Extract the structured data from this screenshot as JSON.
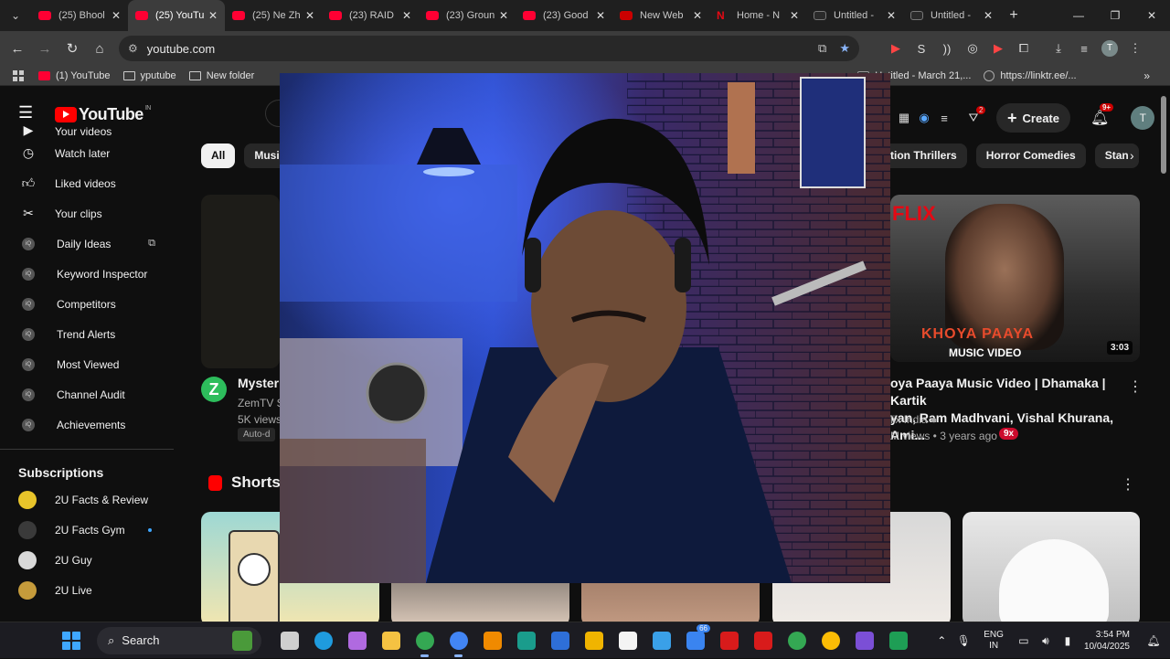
{
  "browser": {
    "tabs": [
      {
        "title": "(25) Bhool",
        "icon": "youtube-icon",
        "active": false
      },
      {
        "title": "(25) YouTu",
        "icon": "youtube-icon",
        "active": true
      },
      {
        "title": "(25) Ne Zh",
        "icon": "youtube-icon",
        "active": false
      },
      {
        "title": "(23) RAID",
        "icon": "youtube-icon",
        "active": false
      },
      {
        "title": "(23) Groun",
        "icon": "youtube-icon",
        "active": false
      },
      {
        "title": "(23) Good",
        "icon": "youtube-icon",
        "active": false
      },
      {
        "title": "New Web",
        "icon": "360-icon",
        "active": false
      },
      {
        "title": "Home - N",
        "icon": "netflix-icon",
        "active": false
      },
      {
        "title": "Untitled -",
        "icon": "app-icon",
        "active": false
      },
      {
        "title": "Untitled -",
        "icon": "app-icon",
        "active": false
      }
    ],
    "url": "youtube.com",
    "bookmarks": [
      {
        "label": "(1) YouTube",
        "icon": "youtube-icon"
      },
      {
        "label": "yputube",
        "icon": "folder-icon"
      },
      {
        "label": "New folder",
        "icon": "folder-icon"
      },
      {
        "label": "Untitled - March 21,...",
        "icon": "app-icon"
      },
      {
        "label": "https://linktr.ee/...",
        "icon": "link-icon"
      }
    ],
    "profile_initial": "T"
  },
  "youtube": {
    "logo_text": "YouTube",
    "logo_region": "IN",
    "create_label": "Create",
    "notifications": "9+",
    "filter_badge": "2",
    "avatar_initial": "T",
    "sidebar": {
      "items": [
        {
          "label": "Your videos",
          "icon": "video-icon"
        },
        {
          "label": "Watch later",
          "icon": "clock-icon"
        },
        {
          "label": "Liked videos",
          "icon": "thumbs-up-icon"
        },
        {
          "label": "Your clips",
          "icon": "scissors-icon"
        },
        {
          "label": "Daily Ideas",
          "icon": "vidiq-icon"
        },
        {
          "label": "Keyword Inspector",
          "icon": "vidiq-icon"
        },
        {
          "label": "Competitors",
          "icon": "vidiq-icon"
        },
        {
          "label": "Trend Alerts",
          "icon": "vidiq-icon"
        },
        {
          "label": "Most Viewed",
          "icon": "vidiq-icon"
        },
        {
          "label": "Channel Audit",
          "icon": "vidiq-icon"
        },
        {
          "label": "Achievements",
          "icon": "vidiq-icon"
        }
      ],
      "subscriptions_title": "Subscriptions",
      "subscriptions": [
        {
          "label": "2U Facts & Review",
          "color": "#e8c42a"
        },
        {
          "label": "2U Facts Gym",
          "color": "#3a3a3a"
        },
        {
          "label": "2U Guy",
          "color": "#d9d9d9"
        },
        {
          "label": "2U Live",
          "color": "#c59b3b"
        }
      ]
    },
    "chips_left": [
      {
        "label": "All",
        "active": true
      },
      {
        "label": "Music",
        "active": false
      }
    ],
    "chips_right": [
      {
        "label": "tion Thrillers"
      },
      {
        "label": "Horror Comedies"
      },
      {
        "label": "Stan"
      }
    ],
    "video_left": {
      "title": "Mysteri",
      "channel": "ZemTV S",
      "meta": "5K views",
      "auto_label": "Auto-d",
      "avatar_letter": "Z"
    },
    "video_right": {
      "brand": "FLIX",
      "thumb_title": "KHOYA PAAYA",
      "thumb_sub": "MUSIC VIDEO",
      "duration": "3:03",
      "title_line1": "oya Paaya Music Video | Dhamaka | Kartik",
      "title_line2": "yan, Ram Madhvani, Vishal Khurana, Ami...",
      "channel": "lix India",
      "meta": "M views • 3 years ago",
      "badge": "9x"
    },
    "shorts_title": "Shorts"
  },
  "taskbar": {
    "search_label": "Search",
    "language_line1": "ENG",
    "language_line2": "IN",
    "time": "3:54 PM",
    "date": "10/04/2025",
    "apps": [
      {
        "name": "task-view-icon",
        "color": "#cfcfcf"
      },
      {
        "name": "edge-icon",
        "color": "#1f9bde"
      },
      {
        "name": "copilot-icon",
        "color": "#b06ae0"
      },
      {
        "name": "file-explorer-icon",
        "color": "#f5c242"
      },
      {
        "name": "chrome-icon",
        "color": "#34a853"
      },
      {
        "name": "chrome-icon",
        "color": "#4285f4"
      },
      {
        "name": "vlc-icon",
        "color": "#f08a00"
      },
      {
        "name": "app-icon",
        "color": "#1a9c8c"
      },
      {
        "name": "terminal-icon",
        "color": "#2e6fd8"
      },
      {
        "name": "app-icon",
        "color": "#f0b400"
      },
      {
        "name": "notepad-icon",
        "color": "#f4f4f4"
      },
      {
        "name": "notes-icon",
        "color": "#3aa0e8"
      },
      {
        "name": "store-icon",
        "color": "#3a84f0"
      },
      {
        "name": "app-icon",
        "color": "#d81b1b"
      },
      {
        "name": "app-icon",
        "color": "#d81b1b"
      },
      {
        "name": "chrome-icon",
        "color": "#34a853"
      },
      {
        "name": "chrome-icon",
        "color": "#fbbc05"
      },
      {
        "name": "app-icon",
        "color": "#7b4fd6"
      },
      {
        "name": "app-icon",
        "color": "#1e9e55"
      }
    ],
    "badge_count": "66"
  }
}
